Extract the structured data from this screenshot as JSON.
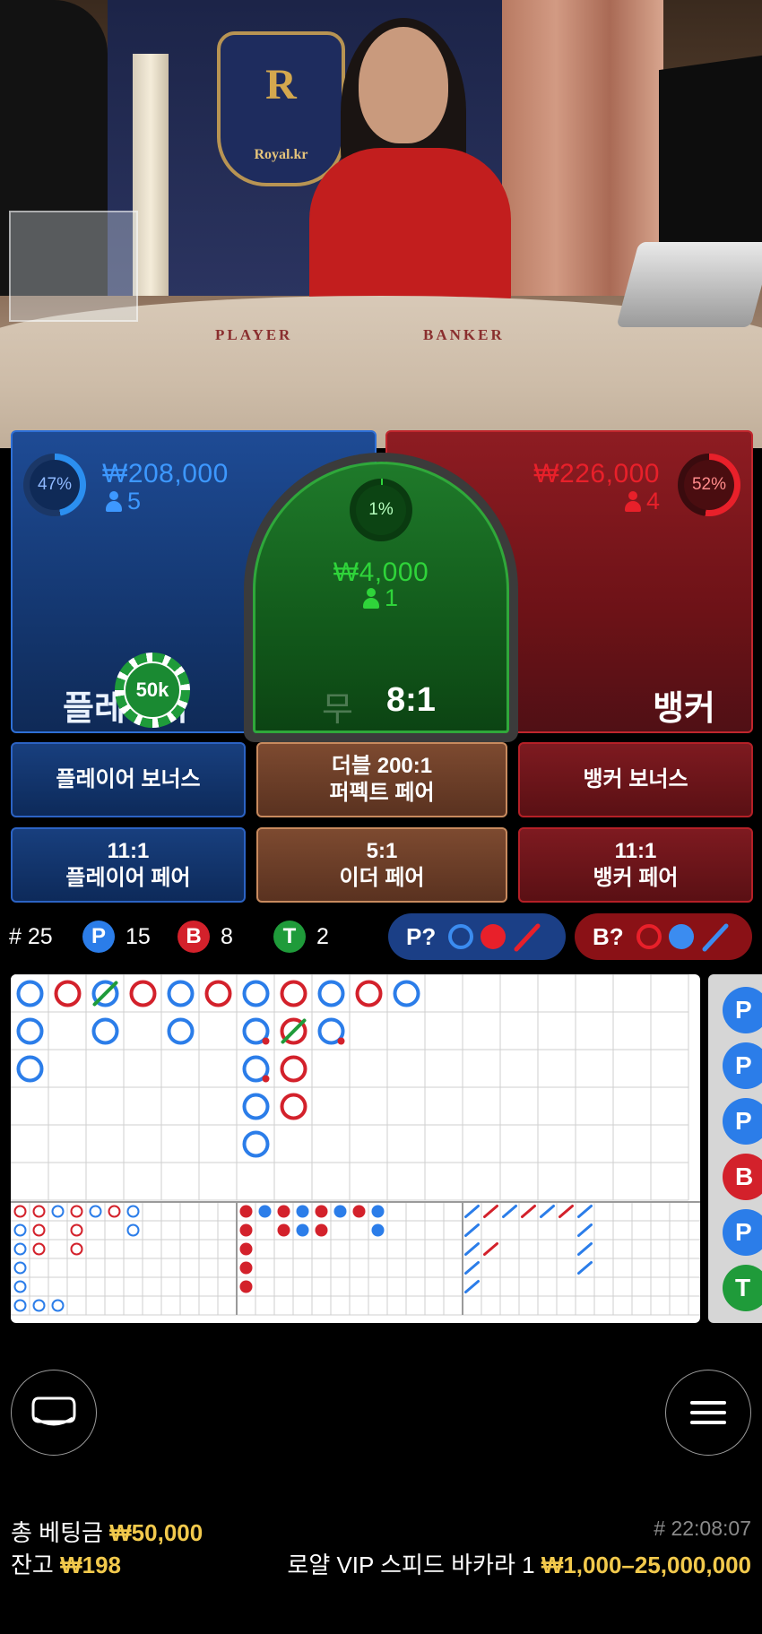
{
  "video": {
    "emblem_letter": "R",
    "emblem_text": "Royal.kr",
    "table_player": "PLAYER",
    "table_banker": "BANKER"
  },
  "player": {
    "percent": "47%",
    "amount": "₩208,000",
    "count": "5",
    "label": "플레이어",
    "percent_value": 47,
    "color": "#2b8ff0"
  },
  "banker": {
    "percent": "52%",
    "amount": "₩226,000",
    "count": "4",
    "label": "뱅커",
    "percent_value": 52,
    "color": "#e8202a"
  },
  "tie": {
    "percent": "1%",
    "amount": "₩4,000",
    "count": "1",
    "label": "무",
    "odds": "8:1",
    "percent_value": 1,
    "color": "#2fd43a"
  },
  "chip": {
    "label": "50k"
  },
  "side_bets": {
    "player_bonus": "플레이어 보너스",
    "perfect_pair_line1": "더블 200:1",
    "perfect_pair_line2": "퍼펙트 페어",
    "banker_bonus": "뱅커 보너스",
    "player_pair_line1": "11:1",
    "player_pair_line2": "플레이어 페어",
    "either_pair_line1": "5:1",
    "either_pair_line2": "이더 페어",
    "banker_pair_line1": "11:1",
    "banker_pair_line2": "뱅커 페어"
  },
  "stats": {
    "rounds": "# 25",
    "player_badge": "P",
    "player_count": "15",
    "banker_badge": "B",
    "banker_count": "8",
    "tie_badge": "T",
    "tie_count": "2",
    "ask_player": "P?",
    "ask_banker": "B?"
  },
  "road": {
    "big_road": [
      {
        "col": 0,
        "row": 0,
        "c": "P"
      },
      {
        "col": 0,
        "row": 1,
        "c": "P"
      },
      {
        "col": 0,
        "row": 2,
        "c": "P"
      },
      {
        "col": 1,
        "row": 0,
        "c": "B"
      },
      {
        "col": 2,
        "row": 0,
        "c": "P",
        "tie": true
      },
      {
        "col": 2,
        "row": 1,
        "c": "P"
      },
      {
        "col": 3,
        "row": 0,
        "c": "B"
      },
      {
        "col": 4,
        "row": 0,
        "c": "P"
      },
      {
        "col": 4,
        "row": 1,
        "c": "P"
      },
      {
        "col": 5,
        "row": 0,
        "c": "B"
      },
      {
        "col": 6,
        "row": 0,
        "c": "P"
      },
      {
        "col": 6,
        "row": 1,
        "c": "P",
        "pair": "B"
      },
      {
        "col": 6,
        "row": 2,
        "c": "P",
        "pair": "B"
      },
      {
        "col": 6,
        "row": 3,
        "c": "P"
      },
      {
        "col": 6,
        "row": 4,
        "c": "P"
      },
      {
        "col": 7,
        "row": 0,
        "c": "B"
      },
      {
        "col": 7,
        "row": 1,
        "c": "B",
        "tie": true
      },
      {
        "col": 7,
        "row": 2,
        "c": "B"
      },
      {
        "col": 7,
        "row": 3,
        "c": "B"
      },
      {
        "col": 8,
        "row": 0,
        "c": "P"
      },
      {
        "col": 8,
        "row": 1,
        "c": "P",
        "pair": "B"
      },
      {
        "col": 9,
        "row": 0,
        "c": "B"
      },
      {
        "col": 10,
        "row": 0,
        "c": "P"
      }
    ],
    "big_eye": [
      [
        0,
        0,
        "B"
      ],
      [
        0,
        1,
        "P"
      ],
      [
        0,
        2,
        "P"
      ],
      [
        0,
        3,
        "P"
      ],
      [
        0,
        4,
        "P"
      ],
      [
        0,
        5,
        "P"
      ],
      [
        1,
        0,
        "B"
      ],
      [
        1,
        1,
        "B"
      ],
      [
        1,
        2,
        "B"
      ],
      [
        1,
        5,
        "P"
      ],
      [
        2,
        0,
        "P"
      ],
      [
        2,
        5,
        "P"
      ],
      [
        3,
        0,
        "B"
      ],
      [
        3,
        1,
        "B"
      ],
      [
        3,
        2,
        "B"
      ],
      [
        4,
        0,
        "P"
      ],
      [
        5,
        0,
        "B"
      ],
      [
        6,
        0,
        "P"
      ],
      [
        6,
        1,
        "P"
      ]
    ],
    "small_road": [
      [
        0,
        0,
        "B"
      ],
      [
        0,
        1,
        "B"
      ],
      [
        0,
        2,
        "B"
      ],
      [
        0,
        3,
        "B"
      ],
      [
        0,
        4,
        "B"
      ],
      [
        1,
        0,
        "P"
      ],
      [
        2,
        0,
        "B"
      ],
      [
        2,
        1,
        "B"
      ],
      [
        3,
        0,
        "P"
      ],
      [
        3,
        1,
        "P"
      ],
      [
        4,
        0,
        "B"
      ],
      [
        4,
        1,
        "B"
      ],
      [
        5,
        0,
        "P"
      ],
      [
        6,
        0,
        "B"
      ],
      [
        7,
        0,
        "P"
      ],
      [
        7,
        1,
        "P"
      ]
    ],
    "cockroach": [
      [
        0,
        0,
        "P"
      ],
      [
        0,
        1,
        "P"
      ],
      [
        0,
        2,
        "P"
      ],
      [
        0,
        3,
        "P"
      ],
      [
        0,
        4,
        "P"
      ],
      [
        1,
        0,
        "B"
      ],
      [
        1,
        2,
        "B"
      ],
      [
        2,
        0,
        "P"
      ],
      [
        3,
        0,
        "B"
      ],
      [
        4,
        0,
        "P"
      ],
      [
        5,
        0,
        "B"
      ],
      [
        6,
        0,
        "P"
      ],
      [
        6,
        1,
        "P"
      ],
      [
        6,
        2,
        "P"
      ],
      [
        6,
        3,
        "P"
      ]
    ],
    "bead_peek": [
      {
        "label": "P",
        "color": "#2b7de9"
      },
      {
        "label": "P",
        "color": "#2b7de9"
      },
      {
        "label": "P",
        "color": "#2b7de9"
      },
      {
        "label": "B",
        "color": "#d3212b"
      },
      {
        "label": "P",
        "color": "#2b7de9"
      },
      {
        "label": "T",
        "color": "#1f9b3a"
      }
    ]
  },
  "footer": {
    "total_bet_label": "총 베팅금",
    "total_bet_value": "₩50,000",
    "balance_label": "잔고",
    "balance_value": "₩198",
    "round_id": "# 22:08:07",
    "table_name": "로얄 VIP 스피드 바카라 1",
    "limits": "₩1,000–25,000,000"
  },
  "colors": {
    "player": "#2b7de9",
    "banker": "#d3212b",
    "tie": "#1f9b3a",
    "gold": "#f2c94c"
  }
}
